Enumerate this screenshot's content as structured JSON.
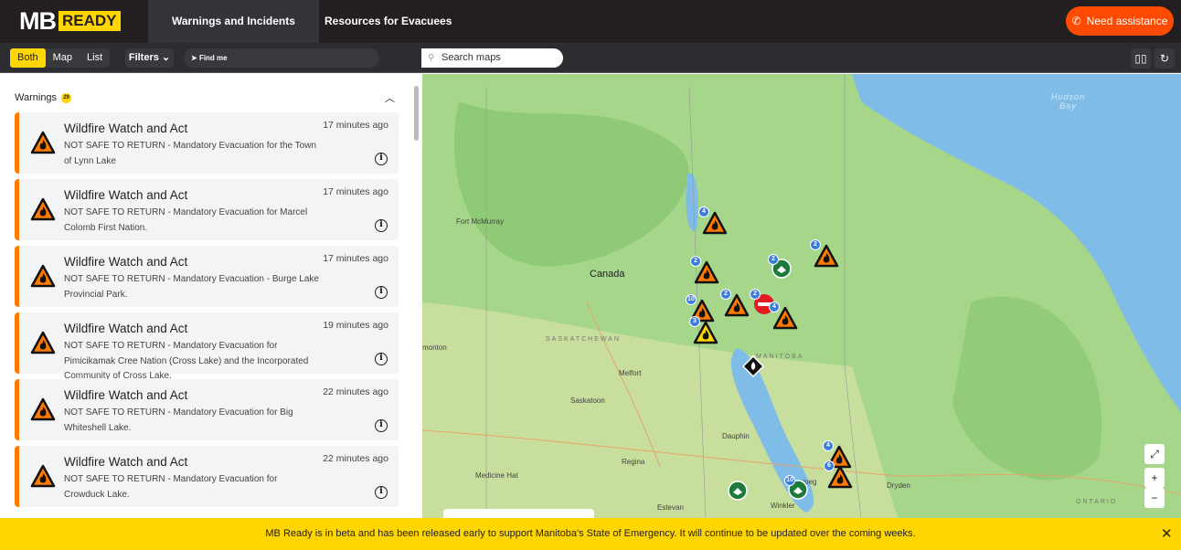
{
  "header": {
    "logo_mb": "MB",
    "logo_ready": "READY",
    "tabs": [
      {
        "label": "Warnings and Incidents",
        "active": true
      },
      {
        "label": "Resources for Evacuees",
        "active": false
      }
    ],
    "assist_label": "Need assistance",
    "assist_color": "#ff4b00"
  },
  "toolbar": {
    "views": [
      "Both",
      "Map",
      "List"
    ],
    "selected_view": "Both",
    "filters_label": "Filters",
    "find_me_label": "Find me",
    "search_placeholder": "Search maps"
  },
  "warnings": {
    "title": "Warnings",
    "count": "29",
    "items": [
      {
        "title": "Wildfire Watch and Act",
        "time": "17 minutes ago",
        "desc": "NOT SAFE TO RETURN - Mandatory Evacuation for the Town of Lynn Lake"
      },
      {
        "title": "Wildfire Watch and Act",
        "time": "17 minutes ago",
        "desc": "NOT SAFE TO RETURN - Mandatory Evacuation for Marcel Colomb First Nation."
      },
      {
        "title": "Wildfire Watch and Act",
        "time": "17 minutes ago",
        "desc": "NOT SAFE TO RETURN - Mandatory Evacuation - Burge Lake Provincial Park."
      },
      {
        "title": "Wildfire Watch and Act",
        "time": "19 minutes ago",
        "desc": "NOT SAFE TO RETURN - Mandatory Evacuation for Pimicikamak Cree Nation (Cross Lake) and the Incorporated Community of Cross Lake."
      },
      {
        "title": "Wildfire Watch and Act",
        "time": "22 minutes ago",
        "desc": "NOT SAFE TO RETURN - Mandatory Evacuation for Big Whiteshell Lake."
      },
      {
        "title": "Wildfire Watch and Act",
        "time": "22 minutes ago",
        "desc": "NOT SAFE TO RETURN - Mandatory Evacuation for Crowduck Lake."
      }
    ]
  },
  "map": {
    "labels": {
      "fort_mcmurray": "Fort McMurray",
      "canada": "Canada",
      "saskatchewan": "SASKATCHEWAN",
      "edmonton": "monton",
      "melfort": "Melfort",
      "saskatoon": "Saskatoon",
      "manitoba": "MANITOBA",
      "dauphin": "Dauphin",
      "regina": "Regina",
      "medicine_hat": "Medicine Hat",
      "estevan": "Estevan",
      "winkler": "Winkler",
      "winnipeg": "Winnipeg",
      "dryden": "Dryden",
      "ontario": "ONTARIO",
      "hudson": "Hudson",
      "bay": "Bay"
    },
    "markers": [
      {
        "type": "wildfire",
        "count": "4"
      },
      {
        "type": "wildfire",
        "count": "2"
      },
      {
        "type": "wildfire",
        "count": "10"
      },
      {
        "type": "wildfire",
        "count": "2"
      },
      {
        "type": "wildfire-advisory",
        "count": "3"
      },
      {
        "type": "road-closed",
        "count": "2"
      },
      {
        "type": "wildfire",
        "count": "4"
      },
      {
        "type": "reception-centre",
        "count": "2"
      },
      {
        "type": "wildfire",
        "count": "2"
      },
      {
        "type": "fire-incident",
        "count": ""
      },
      {
        "type": "wildfire",
        "count": "4"
      },
      {
        "type": "wildfire",
        "count": "6"
      },
      {
        "type": "support-centre",
        "count": ""
      },
      {
        "type": "reception-centre",
        "count": "10"
      }
    ],
    "zoom_in": "+",
    "zoom_out": "−"
  },
  "banner": {
    "text": "MB Ready is in beta and has been released early to support Manitoba's State of Emergency. It will continue to be updated over the coming weeks."
  },
  "colors": {
    "brand_yellow": "#ffd600",
    "warning_orange": "#ff7b00",
    "dark": "#231f20"
  }
}
